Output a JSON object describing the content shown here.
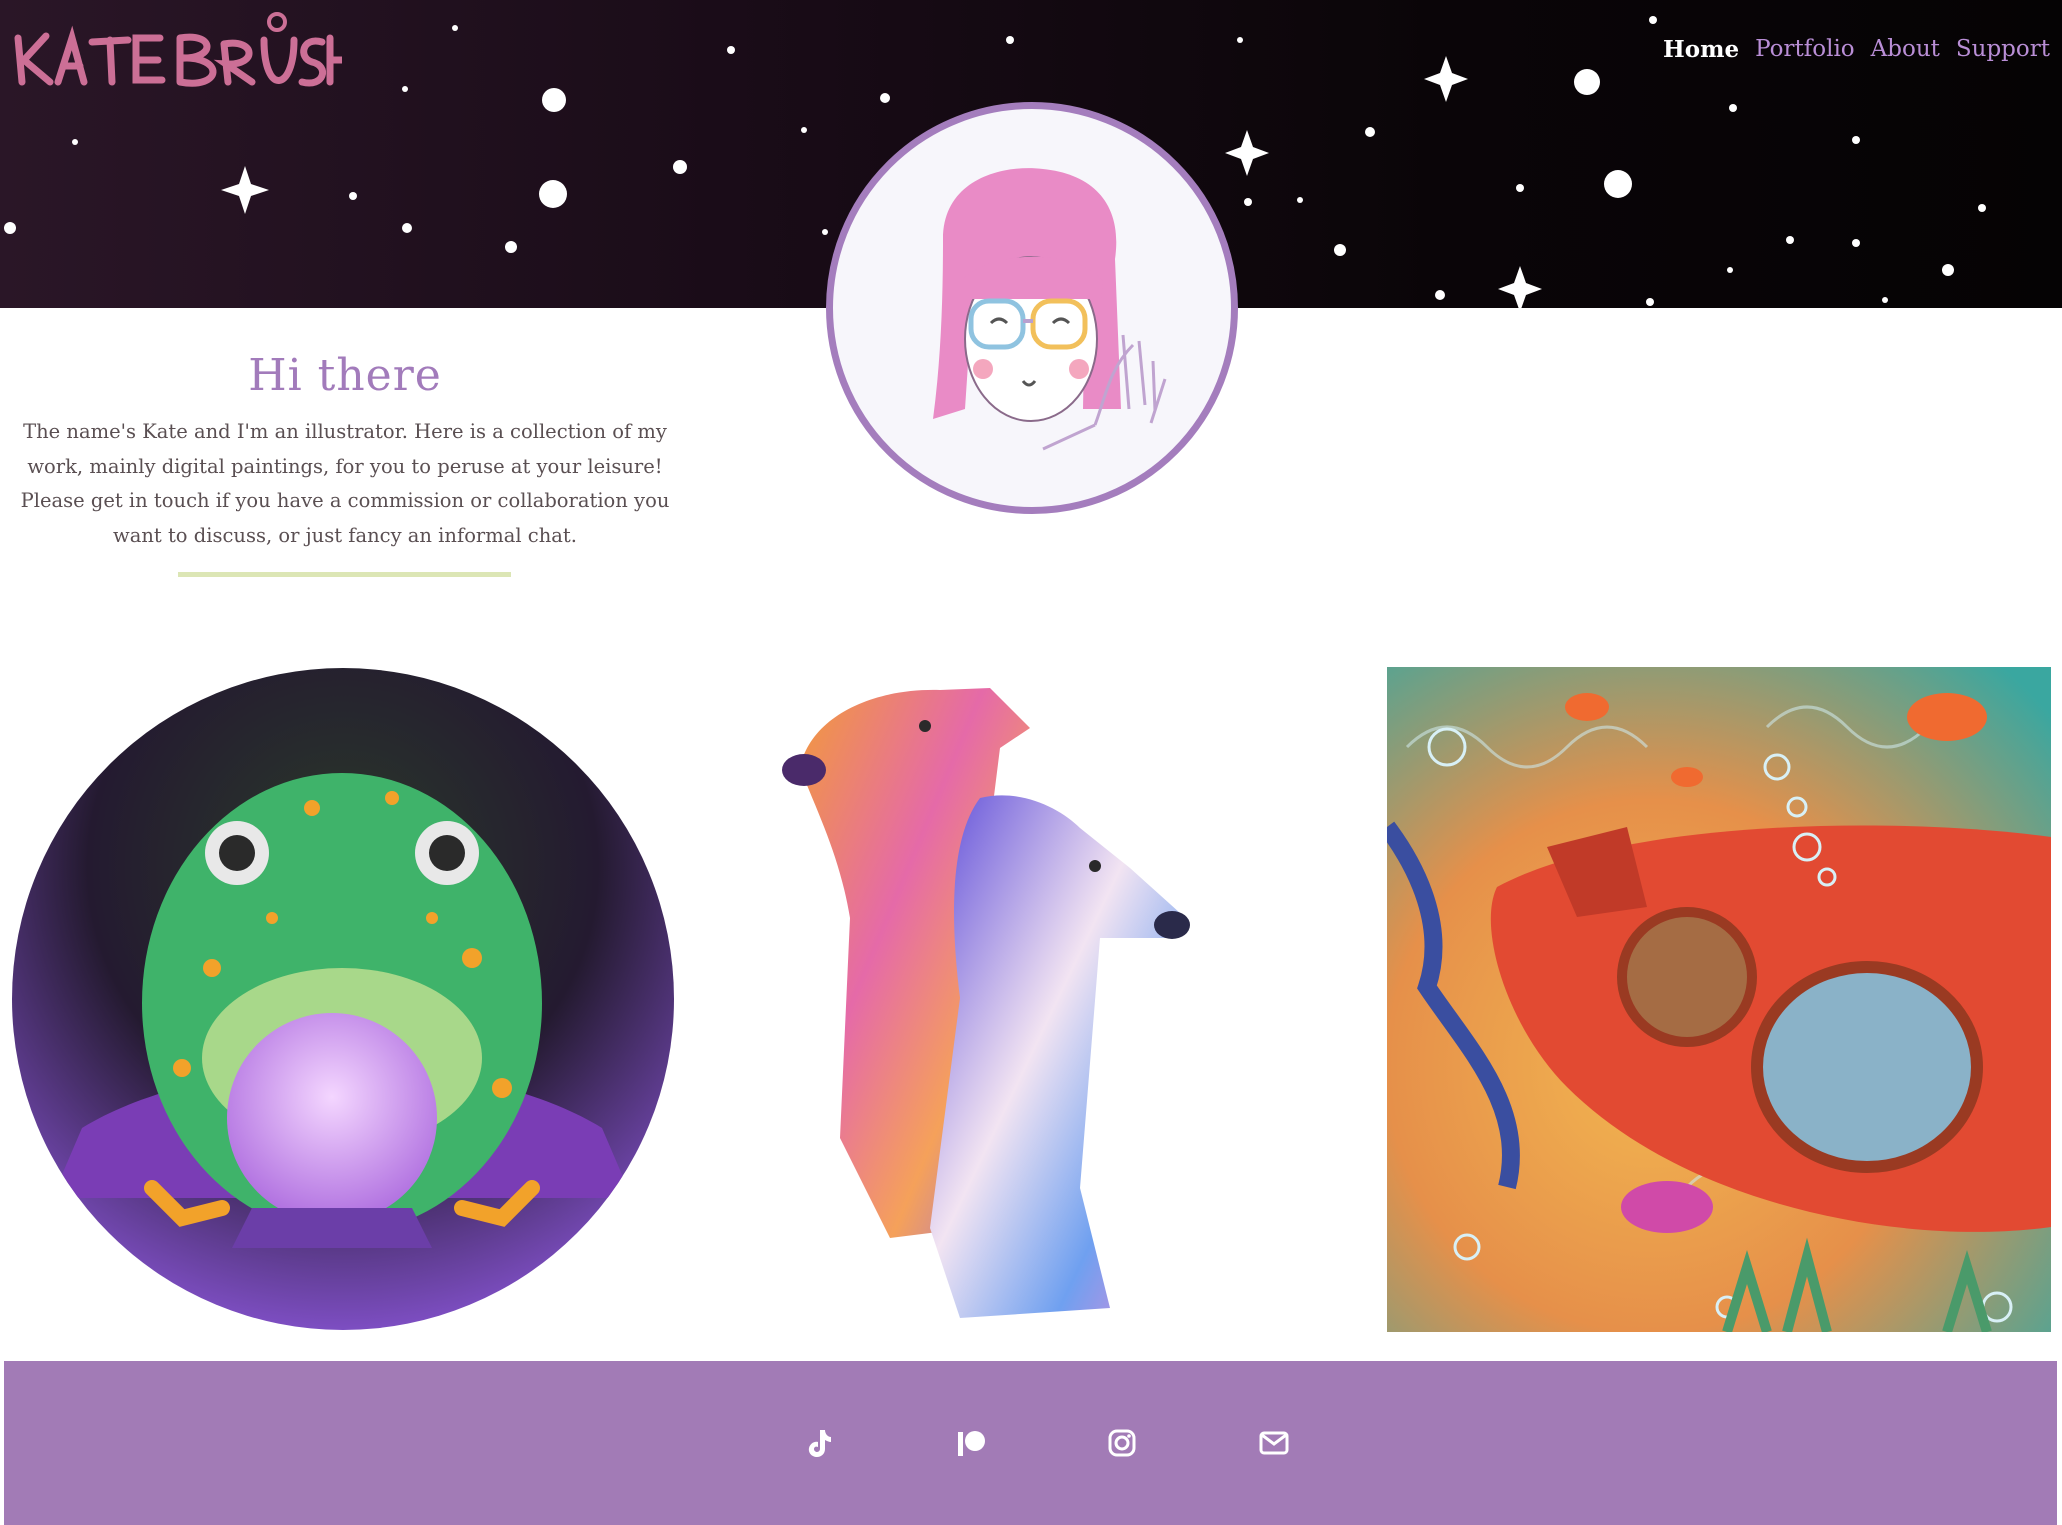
{
  "site": {
    "logo_text": "KATE BRUSH"
  },
  "nav": {
    "items": [
      {
        "label": "Home",
        "active": true
      },
      {
        "label": "Portfolio",
        "active": false
      },
      {
        "label": "About",
        "active": false
      },
      {
        "label": "Support",
        "active": false
      }
    ]
  },
  "intro": {
    "heading": "Hi there",
    "body": "The name's Kate and I'm an illustrator. Here is a collection of my work, mainly digital paintings, for you to peruse at your leisure! Please get in touch if you have a commission or collaboration you want to discuss, or just fancy an informal chat."
  },
  "gallery": [
    {
      "icon": "frog-crystal-ball-illustration"
    },
    {
      "icon": "greyhound-dogs-illustration"
    },
    {
      "icon": "submarine-underwater-illustration"
    }
  ],
  "footer": {
    "social": [
      {
        "icon": "tiktok-icon"
      },
      {
        "icon": "patreon-icon"
      },
      {
        "icon": "instagram-icon"
      },
      {
        "icon": "email-icon"
      }
    ]
  },
  "colors": {
    "accent": "#a27bbb",
    "footer": "#a27bb6",
    "hero": "#0a0508",
    "divider": "#dce6b5"
  }
}
